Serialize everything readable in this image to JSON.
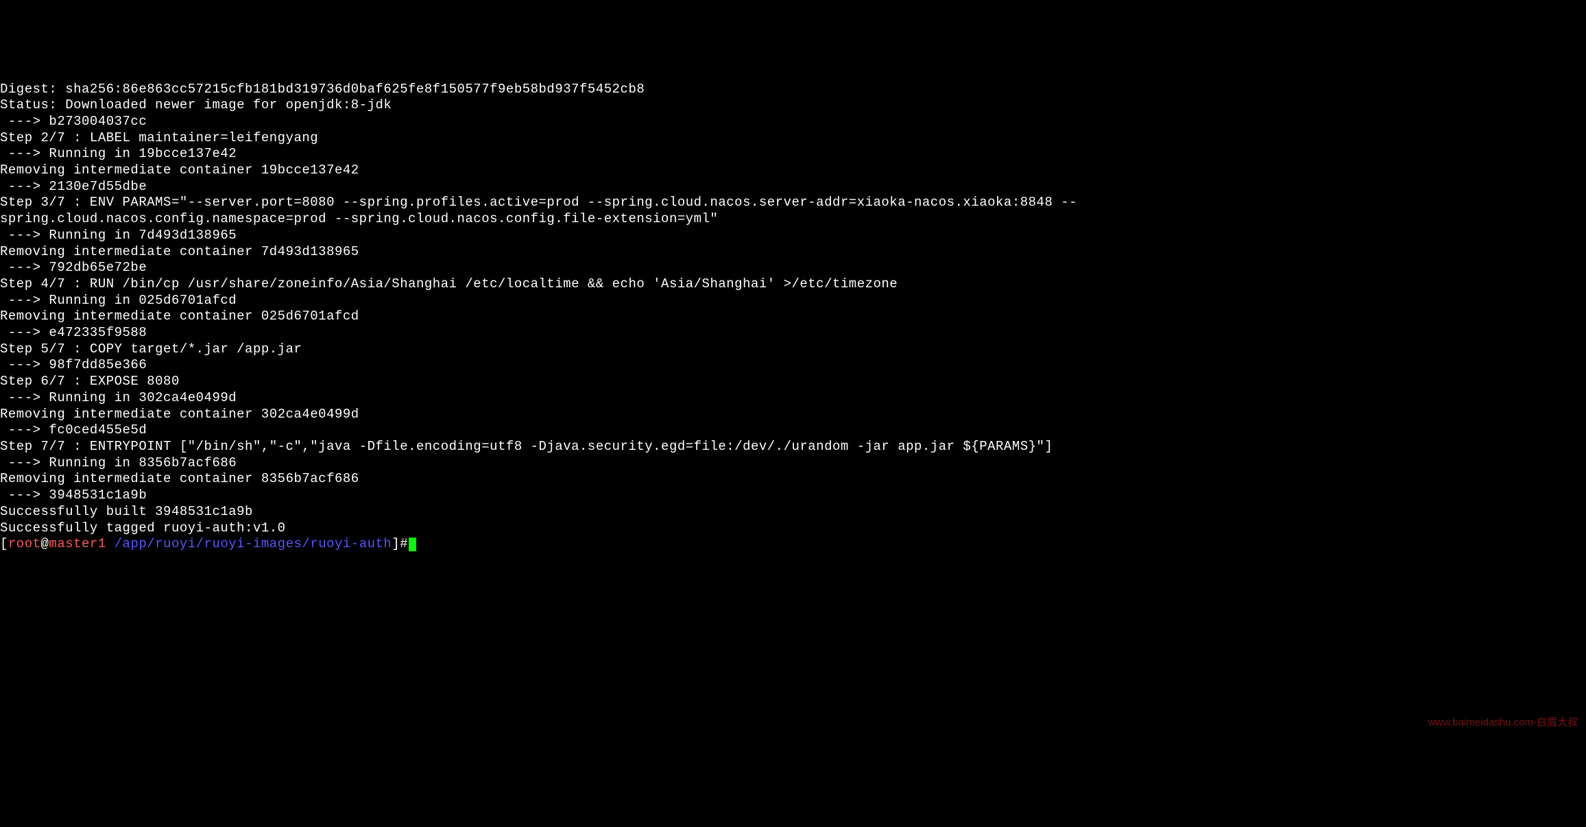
{
  "lines": [
    "Digest: sha256:86e863cc57215cfb181bd319736d0baf625fe8f150577f9eb58bd937f5452cb8",
    "Status: Downloaded newer image for openjdk:8-jdk",
    " ---> b273004037cc",
    "Step 2/7 : LABEL maintainer=leifengyang",
    " ---> Running in 19bcce137e42",
    "Removing intermediate container 19bcce137e42",
    " ---> 2130e7d55dbe",
    "Step 3/7 : ENV PARAMS=\"--server.port=8080 --spring.profiles.active=prod --spring.cloud.nacos.server-addr=xiaoka-nacos.xiaoka:8848 --spring.cloud.nacos.config.namespace=prod --spring.cloud.nacos.config.file-extension=yml\"",
    " ---> Running in 7d493d138965",
    "Removing intermediate container 7d493d138965",
    " ---> 792db65e72be",
    "Step 4/7 : RUN /bin/cp /usr/share/zoneinfo/Asia/Shanghai /etc/localtime && echo 'Asia/Shanghai' >/etc/timezone",
    " ---> Running in 025d6701afcd",
    "Removing intermediate container 025d6701afcd",
    " ---> e472335f9588",
    "Step 5/7 : COPY target/*.jar /app.jar",
    " ---> 98f7dd85e366",
    "Step 6/7 : EXPOSE 8080",
    " ---> Running in 302ca4e0499d",
    "Removing intermediate container 302ca4e0499d",
    " ---> fc0ced455e5d",
    "Step 7/7 : ENTRYPOINT [\"/bin/sh\",\"-c\",\"java -Dfile.encoding=utf8 -Djava.security.egd=file:/dev/./urandom -jar app.jar ${PARAMS}\"]",
    " ---> Running in 8356b7acf686",
    "Removing intermediate container 8356b7acf686",
    " ---> 3948531c1a9b",
    "Successfully built 3948531c1a9b",
    "Successfully tagged ruoyi-auth:v1.0"
  ],
  "prompt": {
    "bracket_open": "[",
    "user": "root",
    "at": "@",
    "host": "master1",
    "space": " ",
    "path": "/app/ruoyi/ruoyi-images/ruoyi-auth",
    "bracket_close": "]",
    "hash": "#"
  },
  "watermark": "www.baimeidashu.com-白眉大叔"
}
